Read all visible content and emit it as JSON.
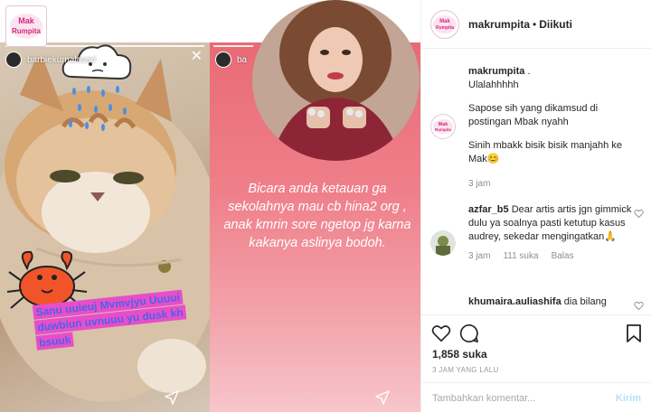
{
  "brand": {
    "logo_text_top": "Mak",
    "logo_text_bottom": "Rumpita"
  },
  "story_left": {
    "username": "barbiekumalasari",
    "caption": "Sanu uuieuj Mvmvjyu Uuuui duwbiun uvnuuu yu dusk kh bsuuk"
  },
  "story_right": {
    "username": "ba",
    "text": "Bicara anda ketauan ga sekolahnya mau cb hina2 org , anak kmrin sore ngetop jg karna kakanya aslinya bodoh."
  },
  "sidebar": {
    "username": "makrumpita",
    "separator": "•",
    "following": "Diikuti",
    "caption": {
      "username": "makrumpita",
      "lines": [
        "Ulalahhhhh",
        "Sapose sih yang dikamsud di postingan Mbak nyahh",
        "Sinih mbakk bisik bisik manjahh ke Mak😊"
      ],
      "time": "3 jam"
    },
    "comments": [
      {
        "username": "azfar_b5",
        "text": "Dear artis artis jgn gimmick dulu ya soalnya pasti ketutup kasus audrey, sekedar mengingatkan🙏",
        "time": "3 jam",
        "likes": "111 suka",
        "reply": "Balas"
      },
      {
        "username": "khumaira.auliashifa",
        "text": "dia bilang",
        "time": "",
        "likes": "",
        "reply": ""
      }
    ],
    "likes": "1,858 suka",
    "time_ago": "3 JAM YANG LALU",
    "comment_placeholder": "Tambahkan komentar...",
    "post_label": "Kirim"
  },
  "colors": {
    "accent_pink": "#e84ec9",
    "link_blue": "#b2dffc",
    "story_right_bg": "#ef7f8a"
  },
  "icons": [
    "rain-cloud-sticker",
    "crab-sticker",
    "close-icon",
    "send-icon",
    "heart-icon",
    "comment-icon",
    "bookmark-icon"
  ]
}
